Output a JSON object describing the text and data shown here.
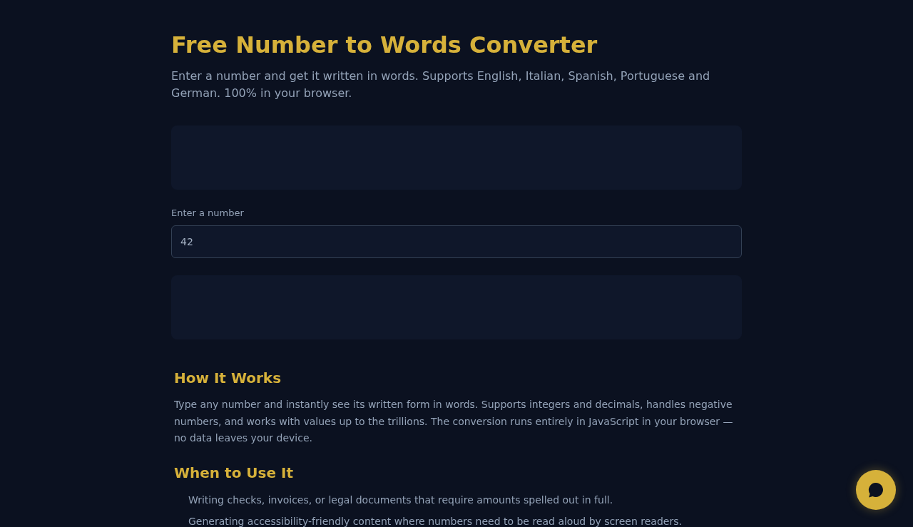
{
  "header": {
    "title": "Free Number to Words Converter",
    "subtitle": "Enter a number and get it written in words. Supports English, Italian, Spanish, Portuguese and German. 100% in your browser."
  },
  "converter": {
    "input_label": "Enter a number",
    "input_value": "42"
  },
  "sections": [
    {
      "kind": "paragraph",
      "heading": "How It Works",
      "text": "Type any number and instantly see its written form in words. Supports integers and decimals, handles negative numbers, and works with values up to the trillions. The conversion runs entirely in JavaScript in your browser — no data leaves your device."
    },
    {
      "kind": "list",
      "heading": "When to Use It",
      "items": [
        "Writing checks, invoices, or legal documents that require amounts spelled out in full.",
        "Generating accessibility-friendly content where numbers need to be read aloud by screen readers."
      ]
    }
  ]
}
